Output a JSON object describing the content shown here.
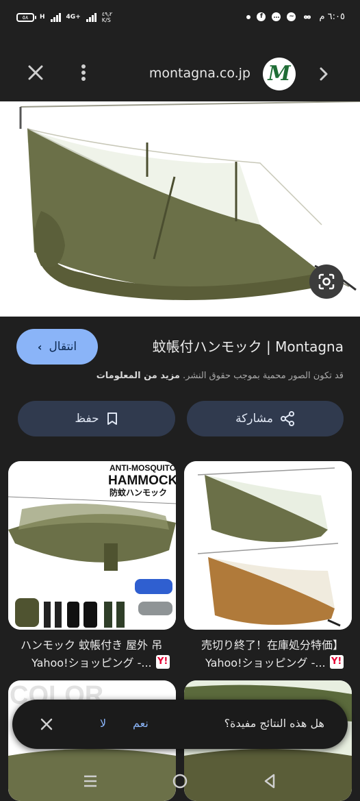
{
  "status_bar": {
    "battery": "٥٨",
    "network_type": "H",
    "network_gen": "4G+",
    "data_speed": "٤٩٫٢",
    "data_unit": "K/S",
    "time": "٦:٠٥ م"
  },
  "top_bar": {
    "domain": "montagna.co.jp",
    "site_logo_letter": "M"
  },
  "result": {
    "title": "蚊帳付ハンモック | Montagna",
    "visit_label": "انتقال",
    "copyright_notice": "قد تكون الصور محمية بموجب حقوق النشر.",
    "more_info": "مزيد من المعلومات",
    "share_label": "مشاركة",
    "save_label": "حفظ"
  },
  "related": [
    {
      "title": "売切り終了！在庫処分特価】",
      "source": "Yahoo!ショッピング -...",
      "source_icon": "Y!"
    },
    {
      "title": "ハンモック 蚊帳付き 屋外 吊",
      "source": "Yahoo!ショッピング -...",
      "source_icon": "Y!",
      "image_text_line1": "ANTI-MOSQUITO",
      "image_text_line2": "HAMMOCK",
      "image_text_line3": "防蚊ハンモック"
    },
    {
      "image_text": "COLOR"
    }
  ],
  "feedback": {
    "question": "هل هذه النتائج مفيدة؟",
    "yes": "نعم",
    "no": "لا"
  },
  "colors": {
    "accent": "#8ab4f8",
    "background": "#1f1f1f",
    "button_bg": "#303a4e",
    "hammock_green": "#6b7048"
  }
}
